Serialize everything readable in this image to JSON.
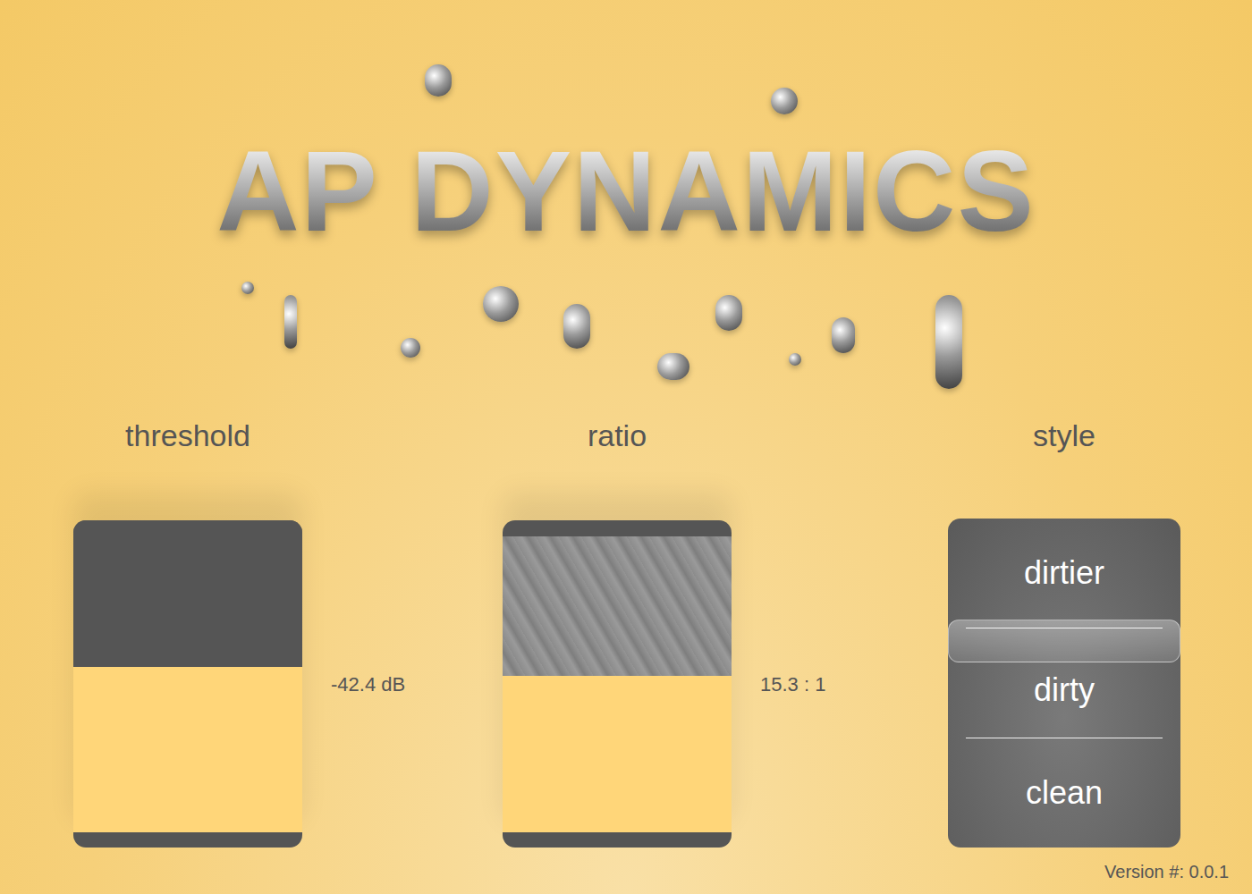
{
  "logo": {
    "title": "AP DYNAMICS"
  },
  "controls": [
    {
      "label": "threshold",
      "kind": "plain",
      "level": 0.53,
      "reading": "-42.4 dB"
    },
    {
      "label": "ratio",
      "kind": "textured",
      "level": 0.53,
      "reading": "15.3 : 1"
    }
  ],
  "style": {
    "label": "style",
    "options": [
      {
        "label": "dirtier",
        "selected": false
      },
      {
        "label": "dirty",
        "selected": true
      },
      {
        "label": "clean",
        "selected": false
      }
    ]
  },
  "version": "Version #: 0.0.1"
}
